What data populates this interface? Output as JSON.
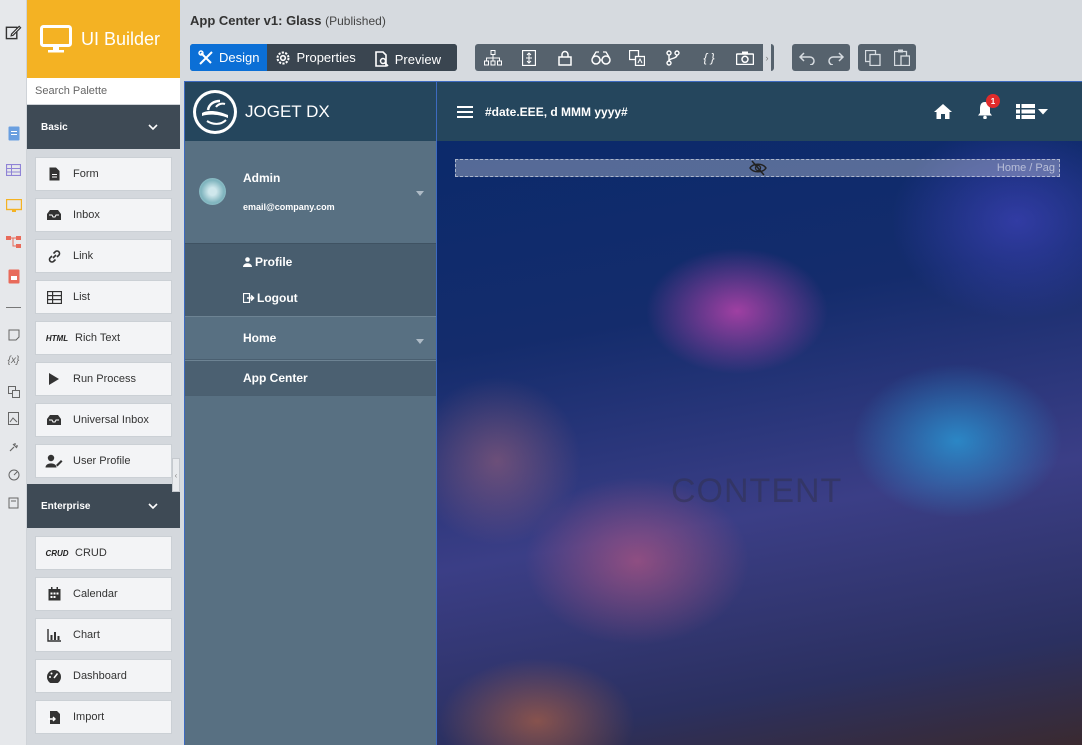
{
  "brand": {
    "title": "UI Builder"
  },
  "header": {
    "title": "App Center v1: Glass",
    "status": "(Published)"
  },
  "toolbar": {
    "design": "Design",
    "properties": "Properties",
    "preview": "Preview"
  },
  "palette": {
    "search_placeholder": "Search Palette",
    "categories": [
      {
        "label": "Basic",
        "items": [
          "Form",
          "Inbox",
          "Link",
          "List",
          "Rich Text",
          "Run Process",
          "Universal Inbox",
          "User Profile"
        ]
      },
      {
        "label": "Enterprise",
        "items": [
          "CRUD",
          "Calendar",
          "Chart",
          "Dashboard",
          "Import"
        ]
      }
    ],
    "icon_text": {
      "html": "HTML",
      "crud": "CRUD"
    }
  },
  "app": {
    "logo_text": "JOGET DX",
    "user": {
      "name": "Admin",
      "email": "email@company.com"
    },
    "user_menu": [
      "Profile",
      "Logout"
    ],
    "menu": [
      "Home",
      "App Center"
    ],
    "date_format": "#date.EEE, d MMM yyyy#",
    "notification_count": "1",
    "breadcrumb": "Home  /  Pag",
    "content_label": "CONTENT"
  },
  "colors": {
    "accent": "#f4b223",
    "primary": "#0b6fd6",
    "dark": "#25465d",
    "sidebar": "#587082"
  }
}
